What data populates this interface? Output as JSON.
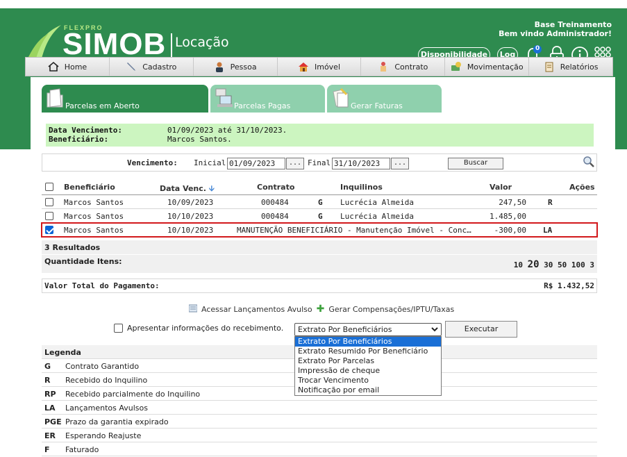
{
  "brand": {
    "flexpro": "FLEXPRO",
    "name": "SIMOB",
    "module": "Locação"
  },
  "user": {
    "company": "Base Treinamento",
    "greeting": "Bem vindo Administrador!",
    "notifications": "0"
  },
  "header_buttons": {
    "disponibilidade": "Disponibilidade",
    "log": "Log"
  },
  "menu": [
    {
      "label": "Home",
      "icon": "home-icon"
    },
    {
      "label": "Cadastro",
      "icon": "pen-icon"
    },
    {
      "label": "Pessoa",
      "icon": "person-icon"
    },
    {
      "label": "Imóvel",
      "icon": "house-icon"
    },
    {
      "label": "Contrato",
      "icon": "contract-icon"
    },
    {
      "label": "Movimentação",
      "icon": "money-icon"
    },
    {
      "label": "Relatórios",
      "icon": "report-icon"
    }
  ],
  "tabs": [
    {
      "label": "Parcelas em Aberto",
      "active": true
    },
    {
      "label": "Parcelas Pagas",
      "active": false
    },
    {
      "label": "Gerar Faturas",
      "active": false
    }
  ],
  "info": {
    "due_label": "Data Vencimento:",
    "due_value": "01/09/2023 até 31/10/2023.",
    "beneficiary_label": "Beneficiário:",
    "beneficiary_value": "Marcos Santos."
  },
  "filter": {
    "label": "Vencimento:",
    "start_label": "Inicial:",
    "start_value": "01/09/2023",
    "end_label": "Final:",
    "end_value": "31/10/2023",
    "picker_label": "...",
    "search_button": "Buscar"
  },
  "table": {
    "headers": {
      "beneficiary": "Beneficiário",
      "due_date": "Data Venc.",
      "contract": "Contrato",
      "tenants": "Inquilinos",
      "value": "Valor",
      "actions": "Ações"
    },
    "rows": [
      {
        "checked": false,
        "beneficiary": "Marcos Santos",
        "due_date": "10/09/2023",
        "contract": "000484",
        "flag": "G",
        "tenant": "Lucrécia Almeida",
        "value": "247,50",
        "action": "R"
      },
      {
        "checked": false,
        "beneficiary": "Marcos Santos",
        "due_date": "10/10/2023",
        "contract": "000484",
        "flag": "G",
        "tenant": "Lucrécia Almeida",
        "value": "1.485,00",
        "action": ""
      },
      {
        "checked": true,
        "beneficiary": "Marcos Santos",
        "due_date": "10/10/2023",
        "contract": "MANUTENÇÃO BENEFICIÁRIO - Manutenção Imóvel - Conc…",
        "flag": "",
        "tenant": "",
        "value": "-300,00",
        "action": "LA"
      }
    ],
    "results": "3 Resultados",
    "qty_label": "Quantidade Itens:",
    "pager": [
      "10",
      "20",
      "30",
      "50",
      "100",
      "3"
    ],
    "pager_current": "20"
  },
  "total": {
    "label": "Valor Total do Pagamento:",
    "value": "R$ 1.432,52"
  },
  "links": {
    "avulso": "Acessar Lançamentos Avulso",
    "compensacoes": "Gerar Compensações/IPTU/Taxas"
  },
  "exec": {
    "checkbox_label": "Apresentar informações do recebimento.",
    "selected": "Extrato Por Beneficiários",
    "button": "Executar",
    "options": [
      "Extrato Por Beneficiários",
      "Extrato Resumido Por Beneficiário",
      "Extrato Por Parcelas",
      "Impressão de cheque",
      "Trocar Vencimento",
      "Notificação por email"
    ]
  },
  "legend": {
    "title": "Legenda",
    "items": [
      {
        "code": "G",
        "desc": "Contrato Garantido"
      },
      {
        "code": "R",
        "desc": "Recebido do Inquilino"
      },
      {
        "code": "RP",
        "desc": "Recebido parcialmente do Inquilino"
      },
      {
        "code": "LA",
        "desc": "Lançamentos Avulsos"
      },
      {
        "code": "PGE",
        "desc": "Prazo da garantia expirado"
      },
      {
        "code": "ER",
        "desc": "Esperando Reajuste"
      },
      {
        "code": "F",
        "desc": "Faturado"
      }
    ]
  },
  "colors": {
    "brand_green": "#2e8b4f",
    "tab_inactive": "#8fd0ad",
    "info_bg": "#ccf5c0",
    "selected_outline": "#d2181b",
    "dropdown_highlight": "#1a6fd6"
  }
}
